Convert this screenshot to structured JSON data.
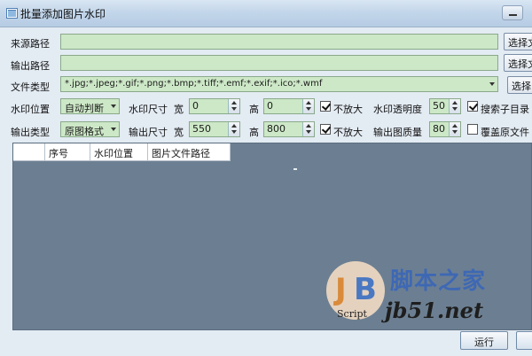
{
  "window": {
    "title": "批量添加图片水印"
  },
  "source": {
    "label": "来源路径",
    "value": "",
    "button": "选择文"
  },
  "output": {
    "label": "输出路径",
    "value": "",
    "button": "选择文"
  },
  "filetype": {
    "label": "文件类型",
    "value": "*.jpg;*.jpeg;*.gif;*.png;*.bmp;*.tiff;*.emf;*.exif;*.ico;*.wmf",
    "button": "选择"
  },
  "watermark_pos": {
    "label": "水印位置",
    "value": "自动判断"
  },
  "watermark_size": {
    "label": "水印尺寸",
    "width_label": "宽",
    "width": "0",
    "height_label": "高",
    "height": "0",
    "no_enlarge": "不放大",
    "no_enlarge_checked": true
  },
  "opacity": {
    "label": "水印透明度",
    "value": "50"
  },
  "search_sub": {
    "label": "搜索子目录",
    "checked": true
  },
  "output_type": {
    "label": "输出类型",
    "value": "原图格式"
  },
  "output_size": {
    "label": "输出尺寸",
    "width_label": "宽",
    "width": "550",
    "height_label": "高",
    "height": "800",
    "no_enlarge": "不放大",
    "no_enlarge_checked": true
  },
  "quality": {
    "label": "输出图质量",
    "value": "80"
  },
  "overwrite": {
    "label": "覆盖原文件",
    "checked": false
  },
  "grid": {
    "columns": [
      "",
      "序号",
      "水印位置",
      "图片文件路径"
    ]
  },
  "actions": {
    "run": "运行"
  },
  "watermark": {
    "logo_text": "Script",
    "cn": "脚本之家",
    "url": "jb51.net"
  }
}
